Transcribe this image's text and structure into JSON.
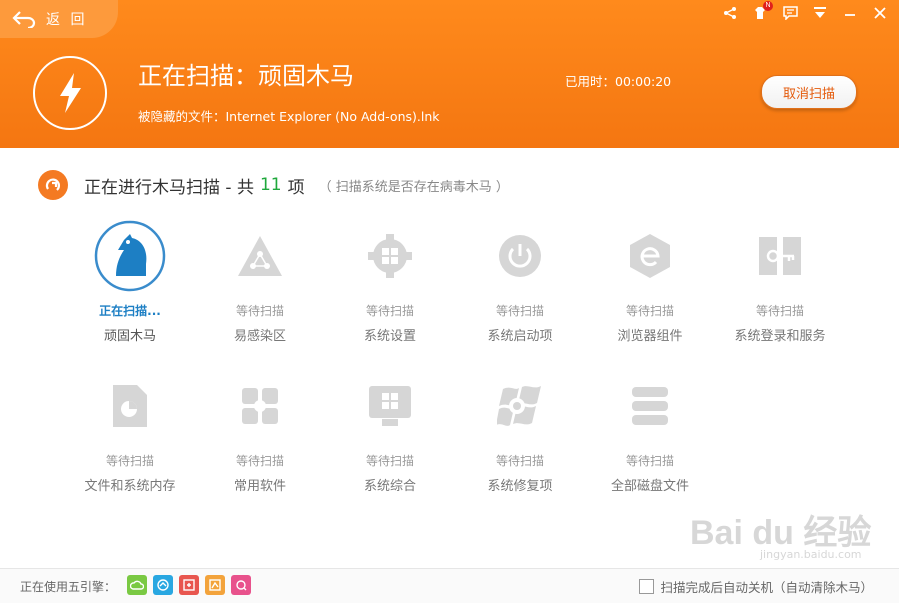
{
  "header": {
    "back_label": "返 回",
    "title": "正在扫描：顽固木马",
    "current_file": "被隐藏的文件：Internet Explorer (No Add-ons).lnk",
    "elapsed": "已用时：00:00:20",
    "cancel_label": "取消扫描",
    "notification_badge": "N"
  },
  "section": {
    "title_prefix": "正在进行木马扫描 - 共",
    "count": "11",
    "title_suffix": "项",
    "note": "（ 扫描系统是否存在病毒木马 ）"
  },
  "scan_items": [
    {
      "status": "正在扫描...",
      "label": "顽固木马",
      "icon": "horse-icon"
    },
    {
      "status": "等待扫描",
      "label": "易感染区",
      "icon": "triangle-network-icon"
    },
    {
      "status": "等待扫描",
      "label": "系统设置",
      "icon": "windows-gear-icon"
    },
    {
      "status": "等待扫描",
      "label": "系统启动项",
      "icon": "power-icon"
    },
    {
      "status": "等待扫描",
      "label": "浏览器组件",
      "icon": "ie-browser-icon"
    },
    {
      "status": "等待扫描",
      "label": "系统登录和服务",
      "icon": "login-key-icon"
    },
    {
      "status": "等待扫描",
      "label": "文件和系统内存",
      "icon": "file-memory-icon"
    },
    {
      "status": "等待扫描",
      "label": "常用软件",
      "icon": "software-grid-icon"
    },
    {
      "status": "等待扫描",
      "label": "系统综合",
      "icon": "windows-monitor-icon"
    },
    {
      "status": "等待扫描",
      "label": "系统修复项",
      "icon": "windows-repair-icon"
    },
    {
      "status": "等待扫描",
      "label": "全部磁盘文件",
      "icon": "disk-stack-icon"
    }
  ],
  "footer": {
    "engine_label": "正在使用五引擎：",
    "engines": [
      {
        "name": "cloud-engine-icon",
        "color": "#7ac943"
      },
      {
        "name": "qvm-engine-icon",
        "color": "#29a7e1"
      },
      {
        "name": "system-repair-engine-icon",
        "color": "#e8564f"
      },
      {
        "name": "bitdefender-engine-icon",
        "color": "#f3a33b"
      },
      {
        "name": "avira-engine-icon",
        "color": "#e8528c"
      }
    ],
    "auto_shutdown_label": "扫描完成后自动关机（自动清除木马）"
  },
  "watermark": {
    "text": "Bai du 经验",
    "sub": "jingyan.baidu.com"
  },
  "colors": {
    "accent": "#f47611",
    "active": "#1d7fc4",
    "count": "#1fa83c"
  }
}
